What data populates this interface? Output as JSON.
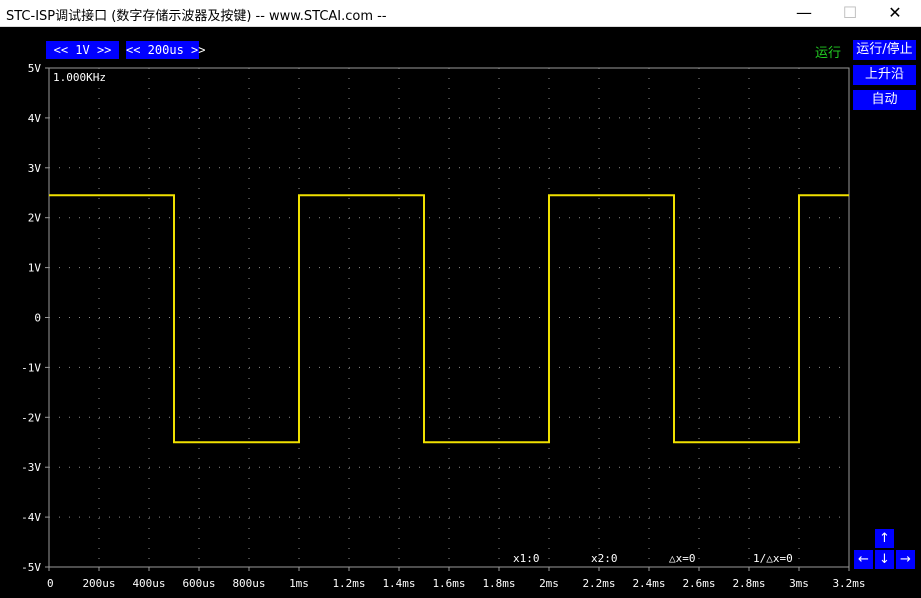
{
  "window": {
    "title": "STC-ISP调试接口 (数字存储示波器及按键) -- www.STCAI.com --",
    "minimize": "—",
    "maximize": "☐",
    "close": "✕"
  },
  "controls": {
    "volt_div": "<<  1V  >>",
    "time_div": "<< 200us >>",
    "status": "运行",
    "run_stop": "运行/停止",
    "trigger_edge": "上升沿",
    "auto": "自动",
    "arrow_up": "↑",
    "arrow_down": "↓",
    "arrow_left": "←",
    "arrow_right": "→"
  },
  "scope": {
    "frequency": "1.000KHz",
    "readouts": {
      "x1": "x1:0",
      "x2": "x2:0",
      "dx": "△x=0",
      "inv_dx": "1/△x=0"
    }
  },
  "chart_data": {
    "type": "line",
    "xlabel": "",
    "ylabel": "",
    "title": "",
    "xlim": [
      0,
      3.2
    ],
    "ylim": [
      -5,
      5
    ],
    "grid": true,
    "y_ticks": [
      "5V",
      "4V",
      "3V",
      "2V",
      "1V",
      "0",
      "-1V",
      "-2V",
      "-3V",
      "-4V",
      "-5V"
    ],
    "x_ticks": [
      "0",
      "200us",
      "400us",
      "600us",
      "800us",
      "1ms",
      "1.2ms",
      "1.4ms",
      "1.6ms",
      "1.8ms",
      "2ms",
      "2.2ms",
      "2.4ms",
      "2.6ms",
      "2.8ms",
      "3ms",
      "3.2ms"
    ],
    "series": [
      {
        "color": "#f0e000",
        "x": [
          0,
          0.5,
          0.5,
          1.0,
          1.0,
          1.5,
          1.5,
          2.0,
          2.0,
          2.5,
          2.5,
          3.0,
          3.0,
          3.2
        ],
        "y": [
          2.45,
          2.45,
          -2.5,
          -2.5,
          2.45,
          2.45,
          -2.5,
          -2.5,
          2.45,
          2.45,
          -2.5,
          -2.5,
          2.45,
          2.45
        ]
      }
    ]
  }
}
